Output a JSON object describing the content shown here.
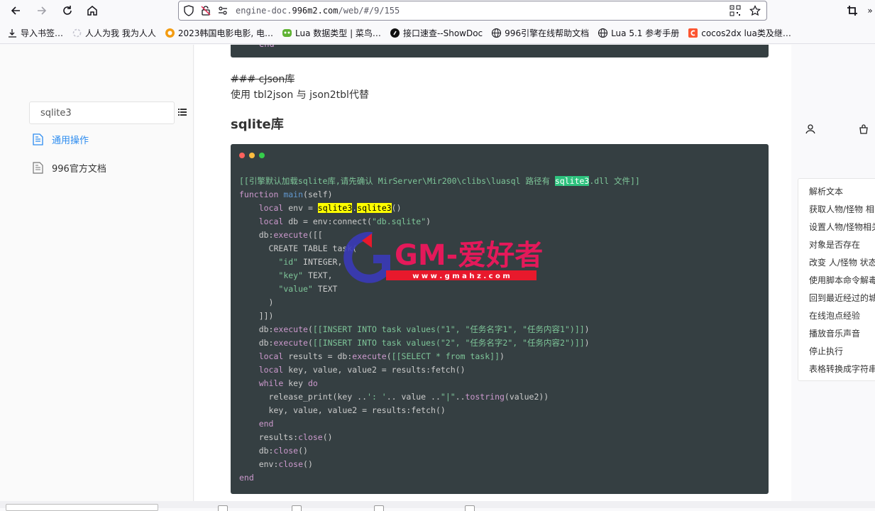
{
  "browser": {
    "url_scheme": "engine-doc.",
    "url_host": "996m2.com",
    "url_path": "/web/#/9/155"
  },
  "bookmarks": [
    {
      "label": "导入书签…",
      "icon": "import-icon"
    },
    {
      "label": "人人为我 我为人人",
      "icon": "loading-icon"
    },
    {
      "label": "2023韩国电影电影, 电…",
      "icon": "site-favicon"
    },
    {
      "label": "Lua 数据类型 | 菜鸟…",
      "icon": "runoob-favicon"
    },
    {
      "label": "接口速查--ShowDoc",
      "icon": "showdoc-favicon"
    },
    {
      "label": "996引擎在线帮助文档",
      "icon": "globe-icon"
    },
    {
      "label": "Lua 5.1 参考手册",
      "icon": "globe-icon"
    },
    {
      "label": "cocos2dx lua类及继…",
      "icon": "csdn-favicon"
    }
  ],
  "sidebar": {
    "search_value": "sqlite3",
    "items": [
      {
        "label": "通用操作"
      },
      {
        "label": "996官方文档"
      }
    ]
  },
  "content": {
    "code_top_tail": "end",
    "md_heading": "### cJson库",
    "md_text": "使用 tbl2json 与 json2tbl代替",
    "section_title": "sqlite库"
  },
  "code_lines": [
    "[[引擎默认加载sqlite库,请先确认 MirServer\\Mir200\\clibs\\luasql 路径有 sqlite3.dll 文件]]",
    "function main(self)",
    "    local env = sqlite3.sqlite3()",
    "    local db = env:connect(\"db.sqlite\")",
    "    db:execute([[",
    "      CREATE TABLE task(",
    "        \"id\" INTEGER,",
    "        \"key\" TEXT,",
    "        \"value\" TEXT",
    "      )",
    "    ]])",
    "    db:execute([[INSERT INTO task values(\"1\", \"任务名字1\", \"任务内容1\")]])",
    "    db:execute([[INSERT INTO task values(\"2\", \"任务名字2\", \"任务内容2\")]])",
    "    local results = db:execute([[SELECT * from task]])",
    "    local key, value, value2 = results:fetch()",
    "    while key do",
    "      release_print(key ..': '.. value ..\"|\"..tostring(value2))",
    "      key, value, value2 = results:fetch()",
    "    end",
    "    results:close()",
    "    db:close()",
    "    env:close()",
    "end"
  ],
  "watermark": {
    "title": "GM-爱好者",
    "url": "w w w . g m a h z . c o m"
  },
  "toc": [
    "解析文本",
    "获取人物/怪物 相",
    "设置人物/怪物相关",
    "对象是否存在",
    "改变 人/怪物 状态",
    "使用脚本命令解毒",
    "回到最近经过的城",
    "在线泡点经验",
    "播放音乐声音",
    "停止执行",
    "表格转换成字符串"
  ],
  "colors": {
    "link_blue": "#2c8cf0",
    "code_bg": "#353f42",
    "highlight_yellow": "#ffff00",
    "highlight_green": "#2ec27e"
  }
}
